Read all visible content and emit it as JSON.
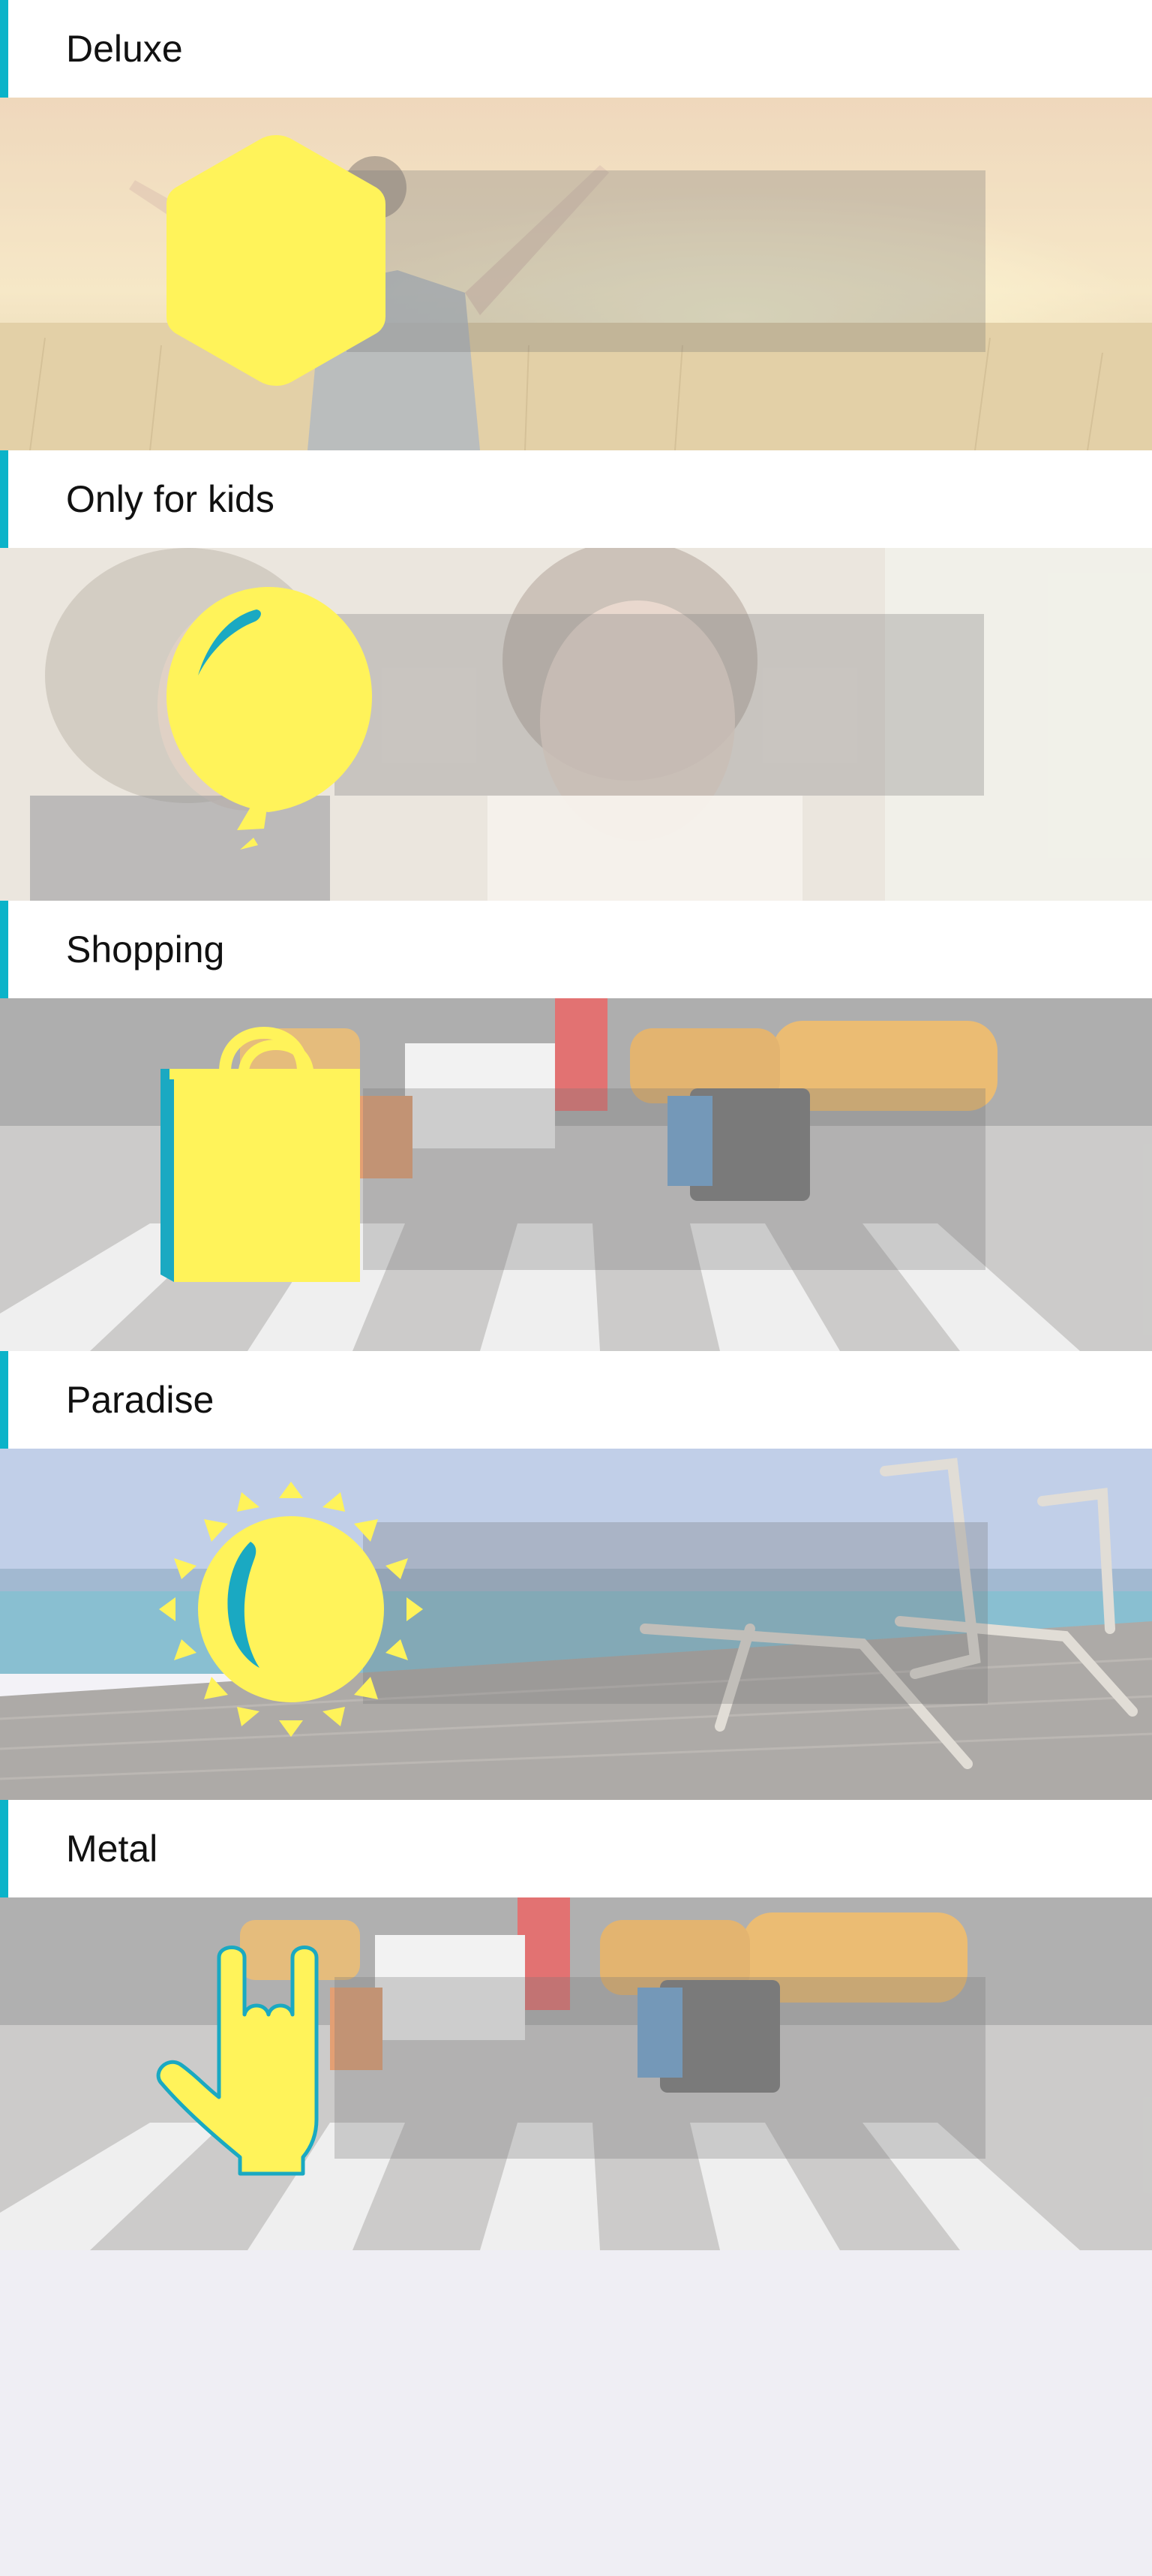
{
  "theme": {
    "accent": "#0bb3c9",
    "icon_yellow": "#fff35a",
    "icon_outline": "#1aa9c2",
    "page_bg": "#efeef4"
  },
  "categories": [
    {
      "title": "Deluxe",
      "icon": "hexagon-icon",
      "scene": "wheat field at sunset"
    },
    {
      "title": "Only for kids",
      "icon": "balloon-icon",
      "scene": "children laughing"
    },
    {
      "title": "Shopping",
      "icon": "shopping-bag-icon",
      "scene": "city crosswalk with taxis"
    },
    {
      "title": "Paradise",
      "icon": "sun-icon",
      "scene": "deck chairs by the sea"
    },
    {
      "title": "Metal",
      "icon": "rock-hand-icon",
      "scene": "city crosswalk with taxis"
    }
  ]
}
